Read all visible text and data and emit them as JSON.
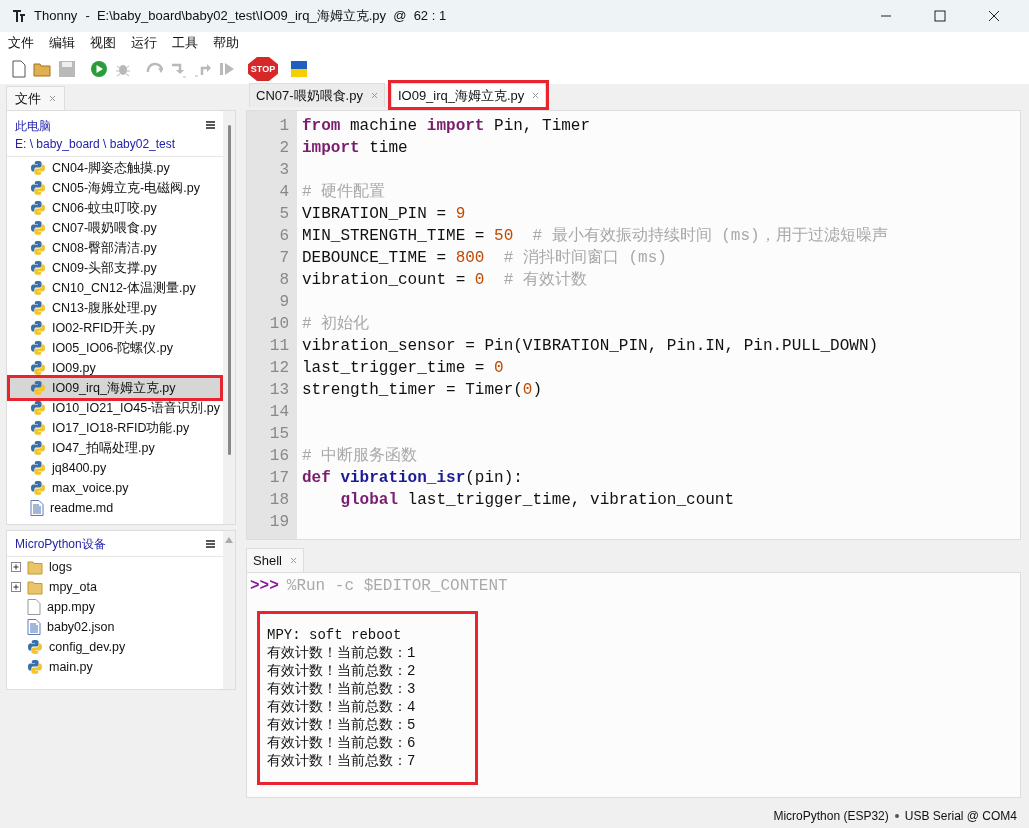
{
  "window": {
    "app": "Thonny",
    "title": "-  E:\\baby_board\\baby02_test\\IO09_irq_海姆立克.py  @  62 : 1"
  },
  "menu": [
    "文件",
    "编辑",
    "视图",
    "运行",
    "工具",
    "帮助"
  ],
  "toolbar": [
    {
      "kind": "new",
      "disabled": false
    },
    {
      "kind": "open",
      "disabled": false
    },
    {
      "kind": "save",
      "disabled": true
    },
    {
      "kind": "run",
      "disabled": false
    },
    {
      "kind": "debug",
      "disabled": true
    },
    {
      "kind": "step-over",
      "disabled": true
    },
    {
      "kind": "step-into",
      "disabled": true
    },
    {
      "kind": "step-out",
      "disabled": true
    },
    {
      "kind": "resume",
      "disabled": true
    },
    {
      "kind": "stop",
      "disabled": false,
      "label": "STOP"
    },
    {
      "kind": "flag",
      "disabled": false
    }
  ],
  "files_panel": {
    "tab": "文件",
    "location": "此电脑",
    "path": "E: \\ baby_board \\ baby02_test",
    "items": [
      {
        "kind": "python",
        "name": "CN04-脚姿态触摸.py",
        "selected": false,
        "highlighted": false
      },
      {
        "kind": "python",
        "name": "CN05-海姆立克-电磁阀.py",
        "selected": false,
        "highlighted": false
      },
      {
        "kind": "python",
        "name": "CN06-蚊虫叮咬.py",
        "selected": false,
        "highlighted": false
      },
      {
        "kind": "python",
        "name": "CN07-喂奶喂食.py",
        "selected": false,
        "highlighted": false
      },
      {
        "kind": "python",
        "name": "CN08-臀部清洁.py",
        "selected": false,
        "highlighted": false
      },
      {
        "kind": "python",
        "name": "CN09-头部支撑.py",
        "selected": false,
        "highlighted": false
      },
      {
        "kind": "python",
        "name": "CN10_CN12-体温测量.py",
        "selected": false,
        "highlighted": false
      },
      {
        "kind": "python",
        "name": "CN13-腹胀处理.py",
        "selected": false,
        "highlighted": false
      },
      {
        "kind": "python",
        "name": "IO02-RFID开关.py",
        "selected": false,
        "highlighted": false
      },
      {
        "kind": "python",
        "name": "IO05_IO06-陀螺仪.py",
        "selected": false,
        "highlighted": false
      },
      {
        "kind": "python",
        "name": "IO09.py",
        "selected": false,
        "highlighted": false
      },
      {
        "kind": "python",
        "name": "IO09_irq_海姆立克.py",
        "selected": true,
        "highlighted": true
      },
      {
        "kind": "python",
        "name": "IO10_IO21_IO45-语音识别.py",
        "selected": false,
        "highlighted": false
      },
      {
        "kind": "python",
        "name": "IO17_IO18-RFID功能.py",
        "selected": false,
        "highlighted": false
      },
      {
        "kind": "python",
        "name": "IO47_拍嗝处理.py",
        "selected": false,
        "highlighted": false
      },
      {
        "kind": "python",
        "name": "jq8400.py",
        "selected": false,
        "highlighted": false
      },
      {
        "kind": "python",
        "name": "max_voice.py",
        "selected": false,
        "highlighted": false
      },
      {
        "kind": "text",
        "name": "readme.md",
        "selected": false,
        "highlighted": false
      }
    ]
  },
  "device_panel": {
    "title": "MicroPython设备",
    "items": [
      {
        "kind": "folder",
        "name": "logs",
        "expanded": false
      },
      {
        "kind": "folder",
        "name": "mpy_ota",
        "expanded": false
      },
      {
        "kind": "blank",
        "name": "app.mpy"
      },
      {
        "kind": "text",
        "name": "baby02.json"
      },
      {
        "kind": "python",
        "name": "config_dev.py"
      },
      {
        "kind": "python",
        "name": "main.py"
      }
    ]
  },
  "editor_tabs": [
    {
      "label": "CN07-喂奶喂食.py",
      "selected": false,
      "highlighted": false
    },
    {
      "label": "IO09_irq_海姆立克.py",
      "selected": true,
      "highlighted": true
    }
  ],
  "editor_lines": [
    {
      "number": "1",
      "tokens": [
        {
          "kind": "kw",
          "text": "from"
        },
        {
          "kind": "plain",
          "text": " machine "
        },
        {
          "kind": "kw",
          "text": "import"
        },
        {
          "kind": "plain",
          "text": " Pin, Timer"
        }
      ]
    },
    {
      "number": "2",
      "tokens": [
        {
          "kind": "kw",
          "text": "import"
        },
        {
          "kind": "plain",
          "text": " time"
        }
      ]
    },
    {
      "number": "3"
    },
    {
      "number": "4",
      "tokens": [
        {
          "kind": "comment",
          "text": "# 硬件配置"
        }
      ]
    },
    {
      "number": "5",
      "tokens": [
        {
          "kind": "plain",
          "text": "VIBRATION_PIN = "
        },
        {
          "kind": "num",
          "text": "9"
        }
      ]
    },
    {
      "number": "6",
      "tokens": [
        {
          "kind": "plain",
          "text": "MIN_STRENGTH_TIME = "
        },
        {
          "kind": "num",
          "text": "50"
        },
        {
          "kind": "comment",
          "text": "  # 最小有效振动持续时间 (ms)，用于过滤短噪声"
        }
      ]
    },
    {
      "number": "7",
      "tokens": [
        {
          "kind": "plain",
          "text": "DEBOUNCE_TIME = "
        },
        {
          "kind": "num",
          "text": "800"
        },
        {
          "kind": "comment",
          "text": "  # 消抖时间窗口 (ms)"
        }
      ]
    },
    {
      "number": "8",
      "tokens": [
        {
          "kind": "plain",
          "text": "vibration_count = "
        },
        {
          "kind": "num",
          "text": "0"
        },
        {
          "kind": "comment",
          "text": "  # 有效计数"
        }
      ]
    },
    {
      "number": "9"
    },
    {
      "number": "10",
      "tokens": [
        {
          "kind": "comment",
          "text": "# 初始化"
        }
      ]
    },
    {
      "number": "11",
      "tokens": [
        {
          "kind": "plain",
          "text": "vibration_sensor = Pin(VIBRATION_PIN, Pin.IN, Pin.PULL_DOWN)"
        }
      ]
    },
    {
      "number": "12",
      "tokens": [
        {
          "kind": "plain",
          "text": "last_trigger_time = "
        },
        {
          "kind": "num",
          "text": "0"
        }
      ]
    },
    {
      "number": "13",
      "tokens": [
        {
          "kind": "plain",
          "text": "strength_timer = Timer("
        },
        {
          "kind": "num",
          "text": "0"
        },
        {
          "kind": "plain",
          "text": ")"
        }
      ]
    },
    {
      "number": "14"
    },
    {
      "number": "15"
    },
    {
      "number": "16",
      "tokens": [
        {
          "kind": "comment",
          "text": "# 中断服务函数"
        }
      ]
    },
    {
      "number": "17",
      "tokens": [
        {
          "kind": "kw",
          "text": "def "
        },
        {
          "kind": "fn",
          "text": "vibration_isr"
        },
        {
          "kind": "plain",
          "text": "(pin):"
        }
      ]
    },
    {
      "number": "18",
      "tokens": [
        {
          "kind": "kw",
          "text": "    global"
        },
        {
          "kind": "plain",
          "text": " last_trigger_time, vibration_count"
        }
      ]
    },
    {
      "number": "19"
    }
  ],
  "shell": {
    "tab": "Shell",
    "prompt": ">>>",
    "command": "%Run -c $EDITOR_CONTENT",
    "output_highlighted": true,
    "output": [
      "MPY: soft reboot",
      "有效计数！当前总数：1",
      "有效计数！当前总数：2",
      "有效计数！当前总数：3",
      "有效计数！当前总数：4",
      "有效计数！当前总数：5",
      "有效计数！当前总数：6",
      "有效计数！当前总数：7"
    ]
  },
  "status_bar": {
    "interpreter": "MicroPython (ESP32)",
    "port": "USB Serial @ COM4"
  }
}
